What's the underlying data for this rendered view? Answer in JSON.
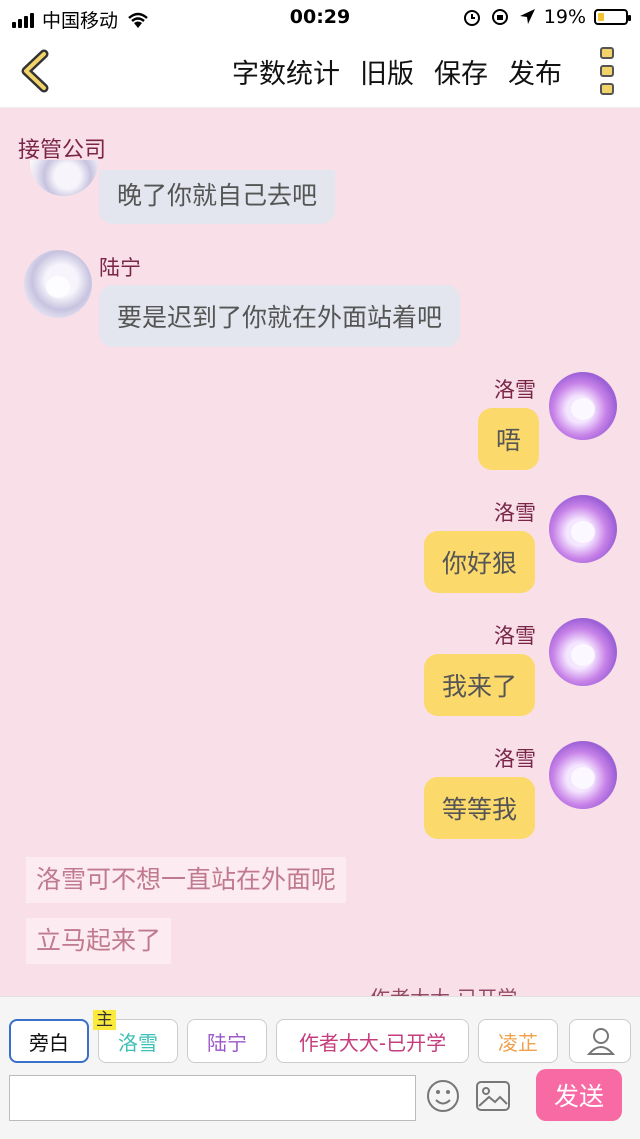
{
  "status_bar": {
    "carrier": "中国移动",
    "time": "00:29",
    "battery_percent": "19%"
  },
  "nav": {
    "actions": [
      "字数统计",
      "旧版",
      "保存",
      "发布"
    ]
  },
  "chat_title": "接管公司",
  "messages": [
    {
      "side": "left",
      "sender": "",
      "text": "晚了你就自己去吧"
    },
    {
      "side": "left",
      "sender": "陆宁",
      "text": "要是迟到了你就在外面站着吧"
    },
    {
      "side": "right",
      "sender": "洛雪",
      "text": "唔"
    },
    {
      "side": "right",
      "sender": "洛雪",
      "text": "你好狠"
    },
    {
      "side": "right",
      "sender": "洛雪",
      "text": "我来了"
    },
    {
      "side": "right",
      "sender": "洛雪",
      "text": "等等我"
    }
  ],
  "narration": [
    "洛雪可不想一直站在外面呢",
    "立马起来了"
  ],
  "partial_sender": "作者大大-已开学",
  "input_panel": {
    "roles": [
      "旁白",
      "洛雪",
      "陆宁",
      "作者大大-已开学",
      "凌芷"
    ],
    "main_badge": "主",
    "input_value": "",
    "input_placeholder": "",
    "send_label": "发送"
  },
  "colors": {
    "background": "#f9dfe7",
    "right_bubble": "#fbd96a",
    "left_bubble": "#e3e6ee",
    "send_button": "#f76aa4",
    "name_color": "#7a2548"
  }
}
